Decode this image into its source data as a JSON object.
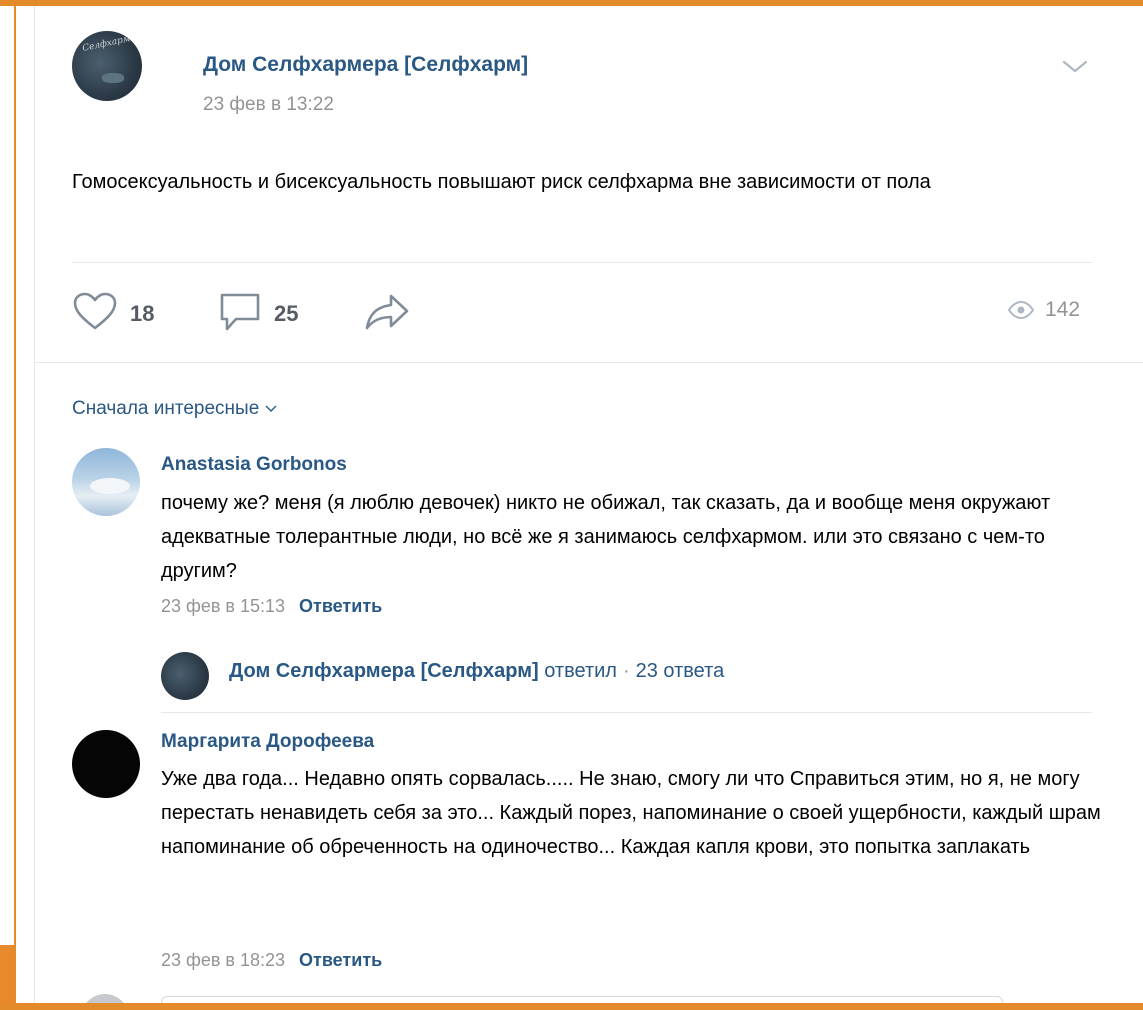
{
  "post": {
    "author": "Дом Селфхармера [Селфхарм]",
    "date": "23 фев в 13:22",
    "text": "Гомосексуальность и бисексуальность повышают риск селфхарма вне зависимости от пола",
    "avatar_text": "Селфхарм",
    "likes": "18",
    "comments": "25",
    "views": "142",
    "icons": {
      "menu": "chevron-down-icon",
      "like": "heart-icon",
      "comment": "comment-icon",
      "share": "share-arrow-icon",
      "views": "eye-icon"
    }
  },
  "comments_section": {
    "sort_label": "Сначала интересные",
    "comments": [
      {
        "author": "Anastasia Gorbonos",
        "text": "почему же? меня (я люблю девочек) никто не обижал, так сказать, да и вообще меня окружают адекватные толерантные люди, но всё же я занимаюсь селфхармом. или это связано с чем-то другим?",
        "date": "23 фев в 15:13",
        "reply_label": "Ответить",
        "thread": {
          "author": "Дом Селфхармера [Селфхарм]",
          "verb": "ответил",
          "separator": "·",
          "count": "23 ответа"
        }
      },
      {
        "author": "Маргарита Дорофеева",
        "text": "Уже два года... Недавно опять сорвалась..... Не знаю, смогу ли что Справиться этим, но я, не могу перестать ненавидеть себя за это... Каждый порез, напоминание о своей ущербности, каждый шрам напоминание об обреченность на одиночество... Каждая капля крови, это попытка заплакать",
        "date": "23 фев в 18:23",
        "reply_label": "Ответить"
      }
    ]
  },
  "colors": {
    "link": "#2a5885",
    "muted": "#939393",
    "frame_accent": "#e38a2b"
  }
}
